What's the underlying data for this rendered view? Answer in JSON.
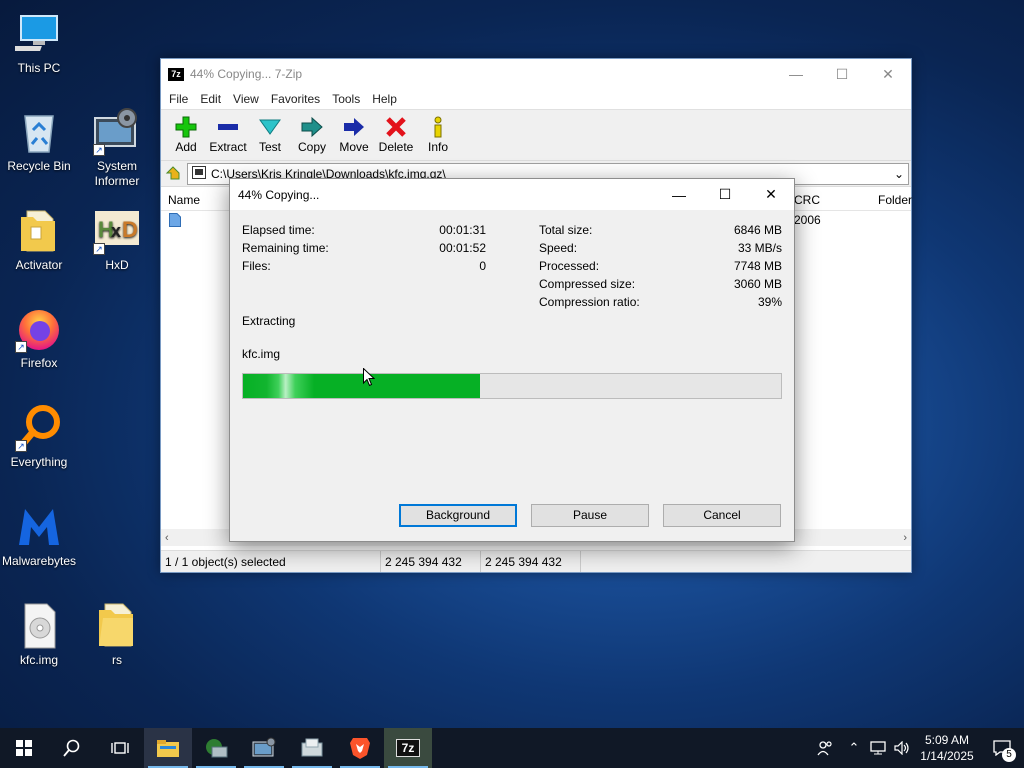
{
  "desktop": {
    "icons": [
      {
        "label": "This PC"
      },
      {
        "label": "Recycle Bin"
      },
      {
        "label": "System Informer"
      },
      {
        "label": "Activator"
      },
      {
        "label": "HxD"
      },
      {
        "label": "Firefox"
      },
      {
        "label": "Everything"
      },
      {
        "label": "Malwarebytes"
      },
      {
        "label": "kfc.img"
      },
      {
        "label": "rs"
      }
    ]
  },
  "main_window": {
    "title": "44% Copying... 7-Zip",
    "badge": "7z",
    "menu": [
      "File",
      "Edit",
      "View",
      "Favorites",
      "Tools",
      "Help"
    ],
    "toolbar": [
      "Add",
      "Extract",
      "Test",
      "Copy",
      "Move",
      "Delete",
      "Info"
    ],
    "address": "C:\\Users\\Kris Kringle\\Downloads\\kfc.img.gz\\",
    "columns": {
      "name": "Name",
      "crc": "CRC",
      "folder": "Folder"
    },
    "crc_value": "2006",
    "status": {
      "selected": "1 / 1 object(s) selected",
      "size": "2 245 394 432",
      "packed": "2 245 394 432"
    }
  },
  "dialog": {
    "title": "44% Copying...",
    "left_stats": [
      {
        "label": "Elapsed time:",
        "value": "00:01:31"
      },
      {
        "label": "Remaining time:",
        "value": "00:01:52"
      },
      {
        "label": "Files:",
        "value": "0"
      }
    ],
    "right_stats": [
      {
        "label": "Total size:",
        "value": "6846 MB"
      },
      {
        "label": "Speed:",
        "value": "33 MB/s"
      },
      {
        "label": "Processed:",
        "value": "7748 MB"
      },
      {
        "label": "Compressed size:",
        "value": "3060 MB"
      },
      {
        "label": "Compression ratio:",
        "value": "39%"
      }
    ],
    "operation": "Extracting",
    "filename": "kfc.img",
    "progress": 0.44,
    "buttons": {
      "background": "Background",
      "pause": "Pause",
      "cancel": "Cancel"
    }
  },
  "taskbar": {
    "clock_time": "5:09 AM",
    "clock_date": "1/14/2025",
    "notification_count": "5",
    "zip_label": "7z"
  },
  "colors": {
    "progress_fill": "#06b025",
    "accent": "#0078d7",
    "taskbar": "#101826"
  }
}
